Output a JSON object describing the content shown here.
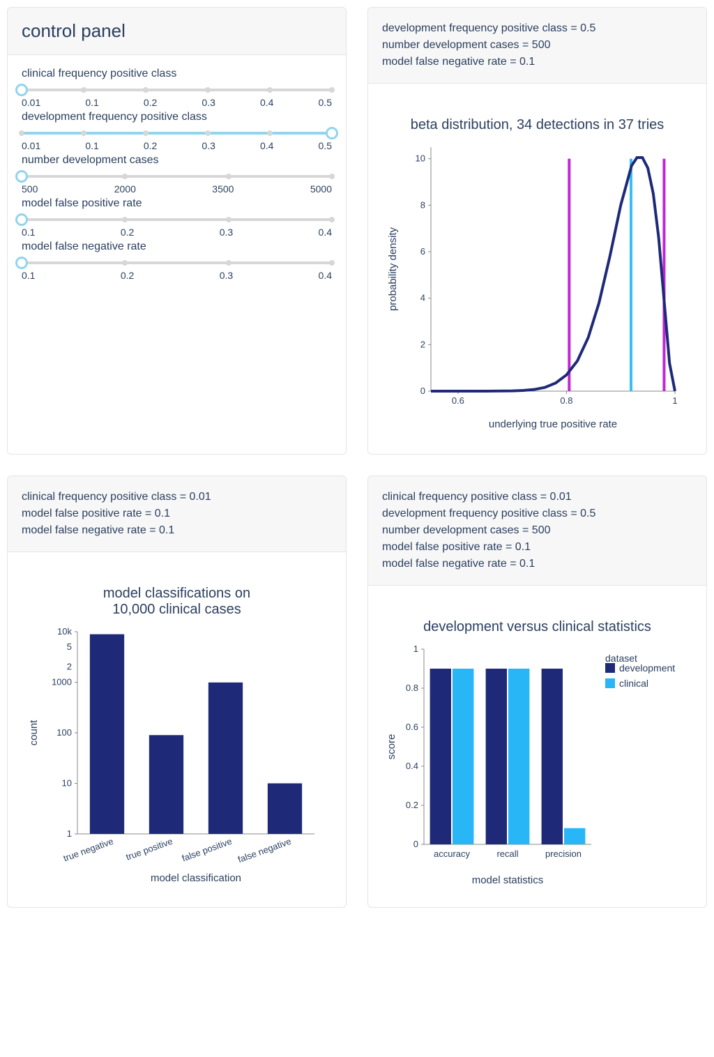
{
  "control_panel": {
    "title": "control panel",
    "sliders": [
      {
        "label": "clinical frequency positive class",
        "ticks": [
          "0.01",
          "0.1",
          "0.2",
          "0.3",
          "0.4",
          "0.5"
        ],
        "value_index": 0
      },
      {
        "label": "development frequency positive class",
        "ticks": [
          "0.01",
          "0.1",
          "0.2",
          "0.3",
          "0.4",
          "0.5"
        ],
        "value_index": 5
      },
      {
        "label": "number development cases",
        "ticks": [
          "500",
          "2000",
          "3500",
          "5000"
        ],
        "value_index": 0
      },
      {
        "label": "model false positive rate",
        "ticks": [
          "0.1",
          "0.2",
          "0.3",
          "0.4"
        ],
        "value_index": 0
      },
      {
        "label": "model false negative rate",
        "ticks": [
          "0.1",
          "0.2",
          "0.3",
          "0.4"
        ],
        "value_index": 0
      }
    ]
  },
  "beta_card": {
    "header_metrics": [
      "development frequency positive class = 0.5",
      "number development cases = 500",
      "model false negative rate = 0.1"
    ],
    "title": "beta distribution, 34 detections in 37 tries",
    "xlabel": "underlying true positive rate",
    "ylabel": "probability density"
  },
  "classifications_card": {
    "header_metrics": [
      "clinical frequency positive class = 0.01",
      "model false positive rate = 0.1",
      "model false negative rate = 0.1"
    ],
    "title": "model classifications on 10,000 clinical cases",
    "xlabel": "model classification",
    "ylabel": "count"
  },
  "stats_card": {
    "header_metrics": [
      "clinical frequency positive class = 0.01",
      "development frequency positive class = 0.5",
      "number development cases = 500",
      "model false positive rate = 0.1",
      "model false negative rate = 0.1"
    ],
    "title": "development versus clinical statistics",
    "xlabel": "model statistics",
    "ylabel": "score",
    "legend_title": "dataset",
    "legend_items": [
      "development",
      "clinical"
    ]
  },
  "chart_data": [
    {
      "type": "line",
      "id": "beta",
      "title": "beta distribution, 34 detections in 37 tries",
      "xlabel": "underlying true positive rate",
      "ylabel": "probability density",
      "xlim": [
        0.55,
        1.0
      ],
      "ylim": [
        0,
        10.5
      ],
      "x": [
        0.55,
        0.6,
        0.65,
        0.7,
        0.72,
        0.74,
        0.76,
        0.78,
        0.8,
        0.82,
        0.84,
        0.86,
        0.88,
        0.9,
        0.92,
        0.93,
        0.94,
        0.95,
        0.96,
        0.97,
        0.98,
        0.99,
        1.0
      ],
      "y": [
        0.0,
        0.0,
        0.0,
        0.01,
        0.03,
        0.07,
        0.16,
        0.35,
        0.7,
        1.3,
        2.3,
        3.8,
        5.8,
        8.0,
        9.7,
        10.05,
        10.05,
        9.6,
        8.5,
        6.6,
        3.9,
        1.2,
        0.0
      ],
      "vlines": [
        {
          "x": 0.805,
          "color": "#c026d3"
        },
        {
          "x": 0.919,
          "color": "#38bdf8"
        },
        {
          "x": 0.98,
          "color": "#c026d3"
        }
      ],
      "x_ticks": [
        0.6,
        0.8,
        1.0
      ],
      "y_ticks": [
        0,
        2,
        4,
        6,
        8,
        10
      ]
    },
    {
      "type": "bar",
      "id": "classifications",
      "title": "model classifications on 10,000 clinical cases",
      "xlabel": "model classification",
      "ylabel": "count",
      "yscale": "log",
      "categories": [
        "true negative",
        "true positive",
        "false positive",
        "false negative"
      ],
      "values": [
        8910,
        90,
        990,
        10
      ],
      "y_ticks": [
        1,
        2,
        5,
        10,
        100,
        1000,
        "2",
        "5",
        "10k"
      ]
    },
    {
      "type": "bar",
      "id": "stats",
      "title": "development versus clinical statistics",
      "xlabel": "model statistics",
      "ylabel": "score",
      "categories": [
        "accuracy",
        "recall",
        "precision"
      ],
      "series": [
        {
          "name": "development",
          "values": [
            0.9,
            0.9,
            0.9
          ],
          "color": "#1e2a78"
        },
        {
          "name": "clinical",
          "values": [
            0.9,
            0.9,
            0.083
          ],
          "color": "#29b6f6"
        }
      ],
      "ylim": [
        0,
        1
      ],
      "y_ticks": [
        0,
        0.2,
        0.4,
        0.6,
        0.8,
        1
      ]
    }
  ]
}
